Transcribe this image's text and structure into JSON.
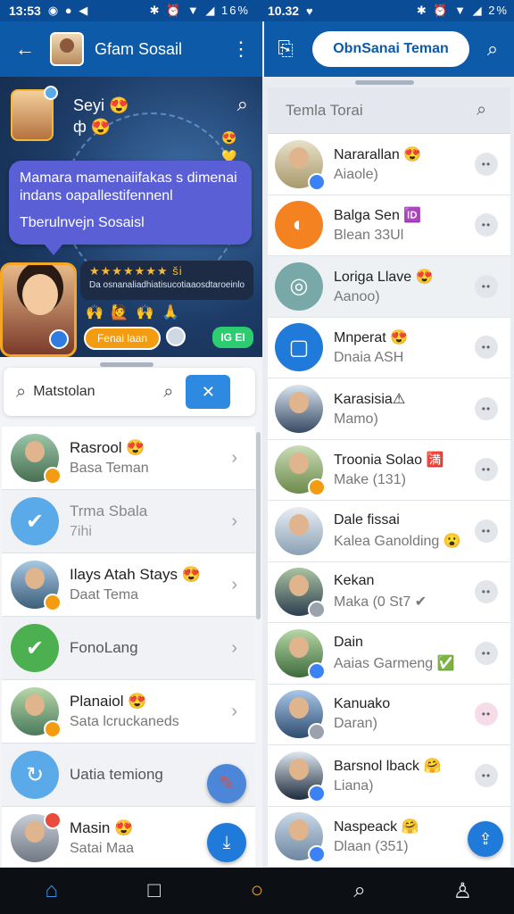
{
  "status_left": {
    "time": "13:53",
    "icons": "◉ ● ◀",
    "right_icons": "✱ ⏰ ▼ ◢ 16%"
  },
  "status_right": {
    "time": "10.32",
    "icons": "♥",
    "right_icons": "✱ ⏰ ▼ ◢ 2%"
  },
  "left_appbar": {
    "back_icon": "←",
    "title": "Gfam Sosail",
    "menu_icon": "⋮"
  },
  "right_appbar": {
    "doc_icon": "⎘",
    "pill_label": "ObnSanai Teman",
    "search_icon": "⌕"
  },
  "hero": {
    "name": "Seyi",
    "name_emoji": "😍",
    "sub": "ф",
    "sub_emoji": "😍",
    "search_icon": "⌕",
    "bubble_line1": "Mamara mamenaiifakas s dimenai indans oapallestifennenl",
    "bubble_line2": "Tberulnvejn Sosaisl",
    "stars": "★★★★★★★ ši",
    "info_text": "Da osnanaliadhiatisucotiaaosdtaroeinlonaitudiet",
    "people": "🙌 🙋 🙌 🙏",
    "tag_label": "Fenai laan",
    "score": "IG EI",
    "right_emojis": [
      "😍",
      "💛"
    ]
  },
  "search": {
    "value": "Matstolan",
    "clear_icon": "✕"
  },
  "left_contacts": [
    {
      "name": "Rasrool",
      "emoji": "😍",
      "sub": "Basa Teman",
      "type": "photo"
    },
    {
      "name": "Trma Sbala",
      "emoji": "",
      "sub": "7ihi",
      "type": "check-icon"
    },
    {
      "name": "Ilays Atah Stays",
      "emoji": "😍",
      "sub": "Daat Tema",
      "type": "photo"
    },
    {
      "name": "FonoLang",
      "emoji": "",
      "sub": "",
      "type": "green-check"
    },
    {
      "name": "Planaiol",
      "emoji": "😍",
      "sub": "Sata lcruckaneds",
      "type": "photo"
    },
    {
      "name": "Uatia temiong",
      "emoji": "",
      "sub": "",
      "type": "refresh-icon"
    },
    {
      "name": "Masin",
      "emoji": "😍",
      "sub": "Satai Maa",
      "type": "photo"
    }
  ],
  "right_search": {
    "placeholder": "Temla Torai"
  },
  "right_contacts": [
    {
      "name": "Nararallan",
      "emoji": "😍",
      "sub": "Aiaole)"
    },
    {
      "name": "Balga Sen",
      "emoji": "🆔",
      "sub": "Blean 33Ul"
    },
    {
      "name": "Loriga Llave",
      "emoji": "😍",
      "sub": "Aanoo)"
    },
    {
      "name": "Mnperat",
      "emoji": "😍",
      "sub": "Dnaia ASH"
    },
    {
      "name": "Karasisia",
      "emoji": "⚠",
      "sub": "Mamo)"
    },
    {
      "name": "Troonia Solao",
      "emoji": "🈵",
      "sub": "Make (131)"
    },
    {
      "name": "Dale fissai",
      "emoji": "",
      "sub": "Kalea Ganolding 😮"
    },
    {
      "name": "Kekan",
      "emoji": "",
      "sub": "Maka (0 St7 ✔"
    },
    {
      "name": "Dain",
      "emoji": "",
      "sub": "Aaias Garmeng ✅"
    },
    {
      "name": "Kanuako",
      "emoji": "",
      "sub": "Daran)"
    },
    {
      "name": "Barsnol lback",
      "emoji": "🤗",
      "sub": "Liana)"
    },
    {
      "name": "Naspeack",
      "emoji": "🤗",
      "sub": "Dlaan (351)"
    }
  ],
  "bottomnav": {
    "home": "⌂",
    "square": "□",
    "circle": "○",
    "search": "⌕",
    "profile": "♙"
  },
  "colors": {
    "appbar": "#0d5aa8",
    "accent": "#1f7ad9",
    "status_bar": "#0b4c96"
  }
}
